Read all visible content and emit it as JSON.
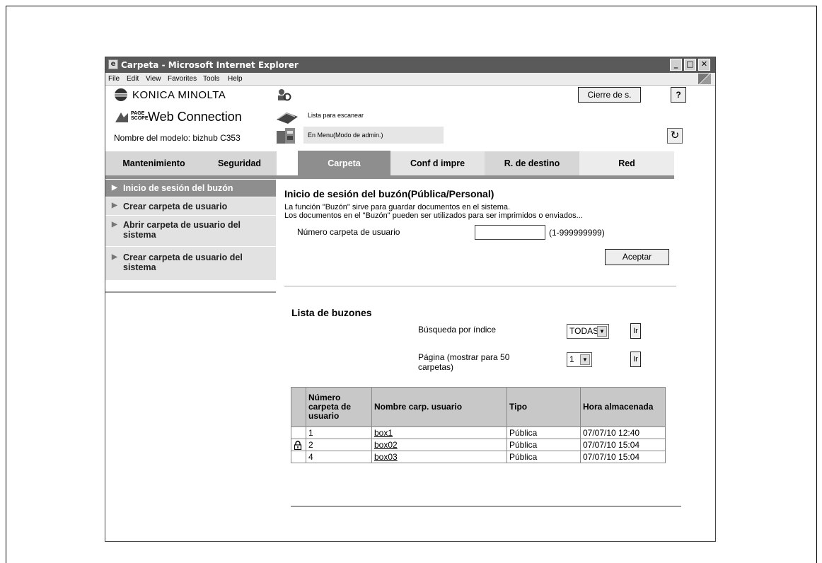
{
  "window": {
    "title": "Carpeta - Microsoft Internet Explorer"
  },
  "menu": [
    "File",
    "Edit",
    "View",
    "Favorites",
    "Tools",
    "Help"
  ],
  "header": {
    "brand": "KONICA MINOLTA",
    "pagescope_small": "PAGE SCOPE",
    "product": "Web Connection",
    "model": "Nombre del modelo: bizhub C353",
    "logout_label": "Cierre de s.",
    "help_label": "?",
    "status_ready": "Lista para escanear",
    "status_mode": "En Menu(Modo de admin.)"
  },
  "tabs": [
    {
      "label": "Mantenimiento",
      "active": false
    },
    {
      "label": "Seguridad",
      "active": false
    },
    {
      "label": "Carpeta",
      "active": true
    },
    {
      "label": "Conf d impre",
      "active": false
    },
    {
      "label": "R. de destino",
      "active": false
    },
    {
      "label": "Red",
      "active": false
    }
  ],
  "sidebar": {
    "items": [
      {
        "label": "Inicio de sesión del buzón",
        "selected": true
      },
      {
        "label": "Crear carpeta de usuario",
        "selected": false
      },
      {
        "label": "Abrir carpeta de usuario del sistema",
        "selected": false
      },
      {
        "label": "Crear carpeta de usuario del sistema",
        "selected": false
      }
    ]
  },
  "login": {
    "heading": "Inicio de sesión del buzón(Pública/Personal)",
    "desc_line1": "La función \"Buzón\" sirve para guardar documentos en el sistema.",
    "desc_line2": "Los documentos en el \"Buzón\" pueden ser utilizados para ser imprimidos o enviados...",
    "field_label": "Número carpeta de usuario",
    "field_value": "",
    "field_range": "(1-999999999)",
    "accept_label": "Aceptar"
  },
  "list": {
    "heading": "Lista de buzones",
    "index_label": "Búsqueda por índice",
    "index_value": "TODAS",
    "page_label_line1": "Página (mostrar para 50",
    "page_label_line2": "carpetas)",
    "page_value": "1",
    "go_label": "Ir",
    "columns": [
      "Número carpeta de usuario",
      "Nombre carp. usuario",
      "Tipo",
      "Hora almacenada"
    ],
    "rows": [
      {
        "locked": false,
        "number": "1",
        "name": "box1",
        "type": "Pública",
        "time": "07/07/10 12:40"
      },
      {
        "locked": true,
        "number": "2",
        "name": "box02",
        "type": "Pública",
        "time": "07/07/10 15:04"
      },
      {
        "locked": false,
        "number": "4",
        "name": "box03",
        "type": "Pública",
        "time": "07/07/10 15:04"
      }
    ]
  }
}
